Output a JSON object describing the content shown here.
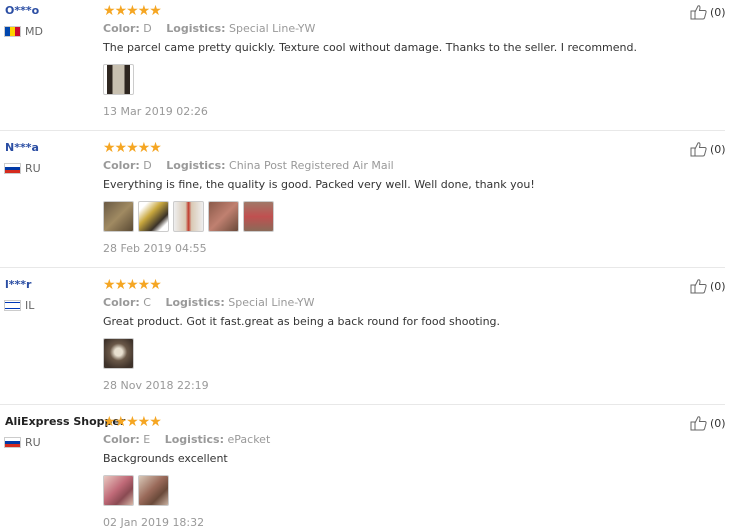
{
  "labels": {
    "color": "Color:",
    "logistics": "Logistics:"
  },
  "reviews": [
    {
      "user": "O***o",
      "country": "MD",
      "color": "D",
      "logistics": "Special Line-YW",
      "text": "The parcel came pretty quickly. Texture cool without damage. Thanks to the seller. I recommend.",
      "date": "13 Mar 2019 02:26",
      "likes": "(0)",
      "stars": "★★★★★",
      "photos": [
        "#3a3028"
      ]
    },
    {
      "user": "N***a",
      "country": "RU",
      "color": "D",
      "logistics": "China Post Registered Air Mail",
      "text": "Everything is fine, the quality is good. Packed very well. Well done, thank you!",
      "date": "28 Feb 2019 04:55",
      "likes": "(0)",
      "stars": "★★★★★",
      "photos": [
        "#8a7a5c",
        "#c9a83e",
        "#d9c9b4",
        "#b07060",
        "#9a6a58"
      ]
    },
    {
      "user": "l***r",
      "country": "IL",
      "color": "C",
      "logistics": "Special Line-YW",
      "text": "Great product. Got it fast.great as being a back round for food shooting.",
      "date": "28 Nov 2018 22:19",
      "likes": "(0)",
      "stars": "★★★★★",
      "photos": [
        "#5a4a3e"
      ]
    },
    {
      "user": "AliExpress Shopper",
      "country": "RU",
      "color": "E",
      "logistics": "ePacket",
      "text": "Backgrounds excellent",
      "date": "02 Jan 2019 18:32",
      "likes": "(0)",
      "stars": "★★★★★",
      "photos": [
        "#c06a78",
        "#9a6a5a"
      ]
    }
  ]
}
